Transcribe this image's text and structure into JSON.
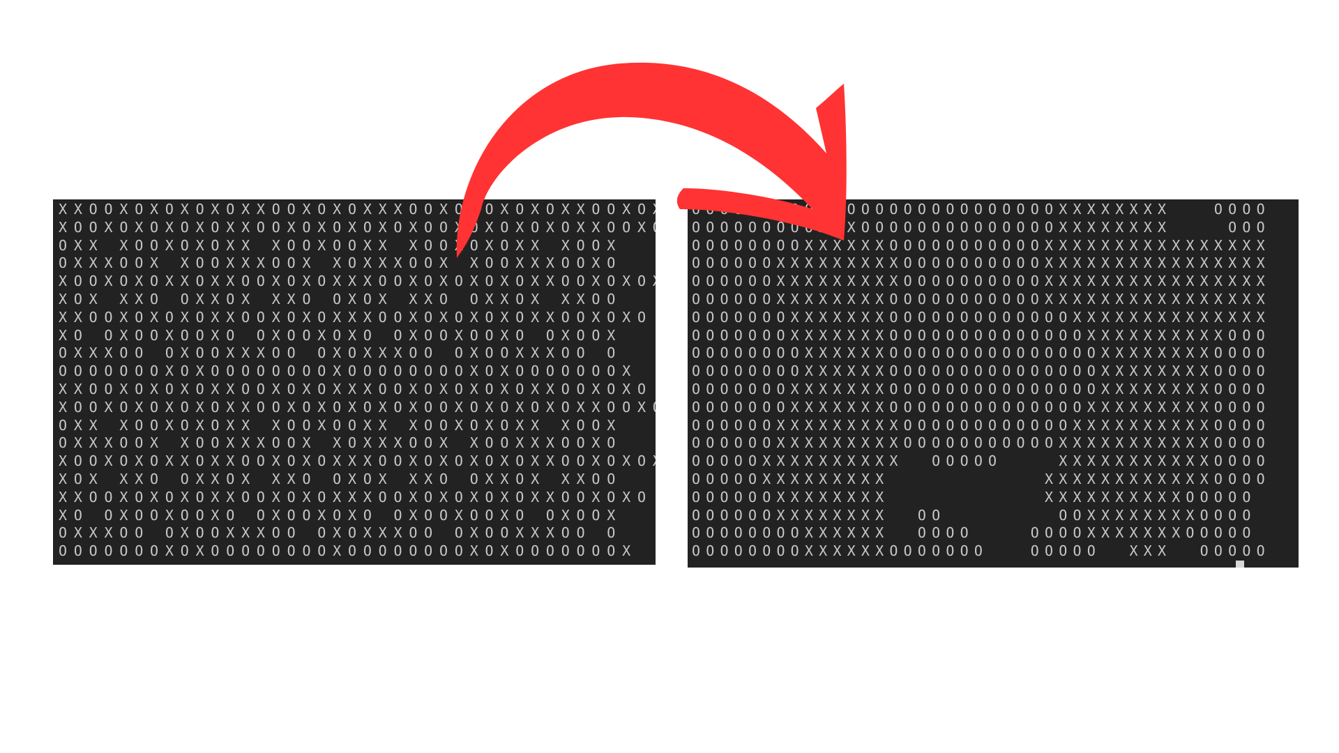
{
  "left_panel": {
    "rows": [
      "XXOOXOXOXOXOXXOOXOXOXXXOOXOXOXOXOXXOOXOXO",
      "XOOXOXOXOXOXXOOXOXOXOXOXOOXOXOXOXOXXOOXOXOX",
      "OXX XOOXOXOXX XOOXOOXX XOOXOXOXX XOOX",
      "OXXXOOX XOOXXXOOX XOXXXOOX XOOXXXOOXO",
      "XOOXOXOXXOXXOOXOXOXXXOOXOXOXOXOXXOOXOXOX",
      "XOX XXO OXXOX XXO OXOX XXO OXXOX XXOO",
      "XXOOXOXOXOXXOOXOXOXXXOOXOXOXOXOXXOOXOXO",
      "XO OXOOXOOXO OXOOXOXO OXOOXOOXO OXOOX",
      "OXXXOO OXOOXXXOO OXOXXXOO OXOOXXXOO O",
      "OOOOOOOXOXOOOOOOOOXOOOOOOOOXOXOOOOOOOX",
      "XXOOXOXOXOXXOOXOXOXXXOOXOXOXOXOXXOOXOXO",
      "XOOXOXOXOXOXXOOXOXOXOXOXOOXOXOXOXOXXOOXOXOX",
      "OXX XOOXOXOXX XOOXOOXX XOOXOXOXX XOOX",
      "OXXXOOX XOOXXXOOX XOXXXOOX XOOXXXOOXO",
      "XOOXOXOXXOXXOOXOXOXXXOOXOXOXOXOXXOOXOXOX",
      "XOX XXO OXXOX XXO OXOX XXO OXXOX XXOO",
      "XXOOXOXOXOXXOOXOXOXXXOOXOXOXOXOXXOOXOXO",
      "XO OXOOXOOXO OXOOXOXO OXOOXOOXO OXOOX",
      "OXXXOO OXOOXXXOO OXOXXXOO OXOOXXXOO O",
      "OOOOOOOXOXOOOOOOOOXOOOOOOOOXOXOOOOOOOX"
    ]
  },
  "right_panel": {
    "rows": [
      "OOOOOOOOOXXOOOOOOOOOOOOOOOXXXXXXXX   OOOO",
      "OOOOOOOOOXXXOOOOOOOOOOOOOOXXXXXXXX    OOO",
      "OOOOOOOOXXXXXXOOOOOOOOOOOXXXXXXXXXXXXXXXX",
      "OOOOOOXXXXXXXXXOOOOOOOOOOXXXXXXXXXXXXXXXX",
      "OOOOOOXXXXXXXXXOOOOOOOOOOXXXXXXXXXXXXXXXX",
      "OOOOOOXXXXXXXXOOOOOOOOOOOXXXXXXXXXXXXXXXX",
      "OOOOOOOXXXXXXXOOOOOOOOOOOOOXXXXXXXXXXXXXX",
      "OOOOOOOXXXXXXXOOOOOOOOOOOOOOXXXXXXXXXXOOO",
      "OOOOOOOOXXXXXXOOOOOOOOOOOOOOOXXXXXXXXOOOO",
      "OOOOOOOOXXXXXXOOOOOOOOOOOOOOOXXXXXXXXOOOO",
      "OOOOOOOXXXXXXXOOOOOOOOOOOOOOOXXXXXXXXOOOO",
      "OOOOOOOXXXXXXXOOOOOOOOOOOOOOXXXXXXXXXOOOO",
      "OOOOOOXXXXXXXXXOOOOOOOOOOOOXXXXXXXXXXOOOO",
      "OOOOOOXXXXXXXXXOOOOOOOOOOOXXXXXXXXXXXOOOO",
      "OOOOOXXXXXXXXXX  OOOOO    XXXXXXXXXXXOOOO",
      "OOOOOXXXXXXXXX           XXXXXXXXXXXXOOOO",
      "OOOOOOXXXXXXXX           XXXXXXXXXXOOOOO",
      "OOOOOOXXXXXXXX  OO        OOXXXXXXXXOOOO",
      "OOOOOOOOXXXXXX  OOOO    OOOOXXXXXXXOOOOO",
      "OOOOOOOOXXXXXXOOOOOOO   OOOOO  XXX  OOOOO"
    ]
  },
  "colors": {
    "panel_background": "#222222",
    "glyph_color": "#c8c8c8",
    "arrow_color": "#ff3333",
    "page_background": "#ffffff"
  },
  "arrow": {
    "icon": "curved-arrow-right"
  }
}
